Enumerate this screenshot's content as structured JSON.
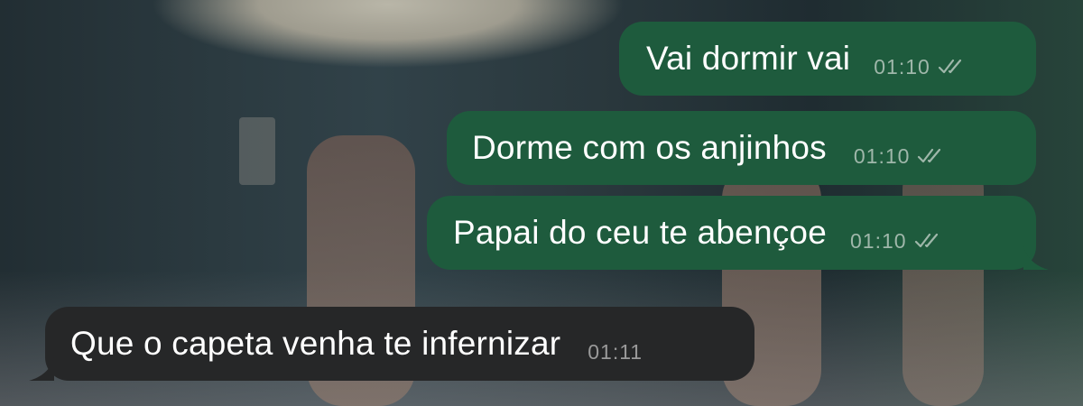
{
  "conversation": {
    "messages": [
      {
        "direction": "outgoing",
        "text": "Vai dormir vai",
        "time": "01:10",
        "status": "read"
      },
      {
        "direction": "outgoing",
        "text": "Dorme com os anjinhos",
        "time": "01:10",
        "status": "read"
      },
      {
        "direction": "outgoing",
        "text": "Papai do ceu te abençoe",
        "time": "01:10",
        "status": "read"
      },
      {
        "direction": "incoming",
        "text": "Que o capeta venha te infernizar",
        "time": "01:11"
      }
    ]
  },
  "colors": {
    "outgoing_bubble": "#1e5b3d",
    "incoming_bubble": "#262728",
    "text": "#ffffff",
    "timestamp_outgoing": "#9fb7aa",
    "timestamp_incoming": "#9a9a9a"
  },
  "icons": {
    "read_receipt": "double-check-icon"
  }
}
